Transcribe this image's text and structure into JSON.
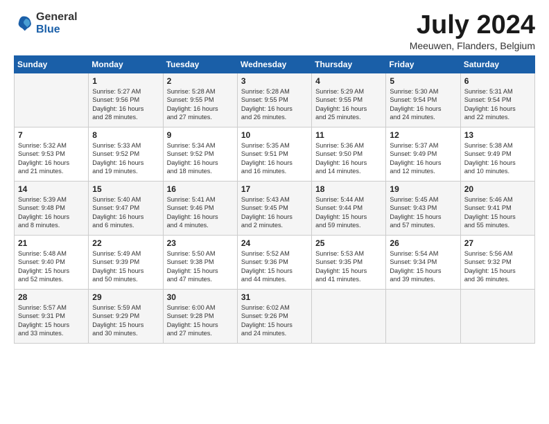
{
  "logo": {
    "general": "General",
    "blue": "Blue"
  },
  "title": "July 2024",
  "location": "Meeuwen, Flanders, Belgium",
  "days_header": [
    "Sunday",
    "Monday",
    "Tuesday",
    "Wednesday",
    "Thursday",
    "Friday",
    "Saturday"
  ],
  "weeks": [
    [
      {
        "day": "",
        "content": ""
      },
      {
        "day": "1",
        "content": "Sunrise: 5:27 AM\nSunset: 9:56 PM\nDaylight: 16 hours\nand 28 minutes."
      },
      {
        "day": "2",
        "content": "Sunrise: 5:28 AM\nSunset: 9:55 PM\nDaylight: 16 hours\nand 27 minutes."
      },
      {
        "day": "3",
        "content": "Sunrise: 5:28 AM\nSunset: 9:55 PM\nDaylight: 16 hours\nand 26 minutes."
      },
      {
        "day": "4",
        "content": "Sunrise: 5:29 AM\nSunset: 9:55 PM\nDaylight: 16 hours\nand 25 minutes."
      },
      {
        "day": "5",
        "content": "Sunrise: 5:30 AM\nSunset: 9:54 PM\nDaylight: 16 hours\nand 24 minutes."
      },
      {
        "day": "6",
        "content": "Sunrise: 5:31 AM\nSunset: 9:54 PM\nDaylight: 16 hours\nand 22 minutes."
      }
    ],
    [
      {
        "day": "7",
        "content": "Sunrise: 5:32 AM\nSunset: 9:53 PM\nDaylight: 16 hours\nand 21 minutes."
      },
      {
        "day": "8",
        "content": "Sunrise: 5:33 AM\nSunset: 9:52 PM\nDaylight: 16 hours\nand 19 minutes."
      },
      {
        "day": "9",
        "content": "Sunrise: 5:34 AM\nSunset: 9:52 PM\nDaylight: 16 hours\nand 18 minutes."
      },
      {
        "day": "10",
        "content": "Sunrise: 5:35 AM\nSunset: 9:51 PM\nDaylight: 16 hours\nand 16 minutes."
      },
      {
        "day": "11",
        "content": "Sunrise: 5:36 AM\nSunset: 9:50 PM\nDaylight: 16 hours\nand 14 minutes."
      },
      {
        "day": "12",
        "content": "Sunrise: 5:37 AM\nSunset: 9:49 PM\nDaylight: 16 hours\nand 12 minutes."
      },
      {
        "day": "13",
        "content": "Sunrise: 5:38 AM\nSunset: 9:49 PM\nDaylight: 16 hours\nand 10 minutes."
      }
    ],
    [
      {
        "day": "14",
        "content": "Sunrise: 5:39 AM\nSunset: 9:48 PM\nDaylight: 16 hours\nand 8 minutes."
      },
      {
        "day": "15",
        "content": "Sunrise: 5:40 AM\nSunset: 9:47 PM\nDaylight: 16 hours\nand 6 minutes."
      },
      {
        "day": "16",
        "content": "Sunrise: 5:41 AM\nSunset: 9:46 PM\nDaylight: 16 hours\nand 4 minutes."
      },
      {
        "day": "17",
        "content": "Sunrise: 5:43 AM\nSunset: 9:45 PM\nDaylight: 16 hours\nand 2 minutes."
      },
      {
        "day": "18",
        "content": "Sunrise: 5:44 AM\nSunset: 9:44 PM\nDaylight: 15 hours\nand 59 minutes."
      },
      {
        "day": "19",
        "content": "Sunrise: 5:45 AM\nSunset: 9:43 PM\nDaylight: 15 hours\nand 57 minutes."
      },
      {
        "day": "20",
        "content": "Sunrise: 5:46 AM\nSunset: 9:41 PM\nDaylight: 15 hours\nand 55 minutes."
      }
    ],
    [
      {
        "day": "21",
        "content": "Sunrise: 5:48 AM\nSunset: 9:40 PM\nDaylight: 15 hours\nand 52 minutes."
      },
      {
        "day": "22",
        "content": "Sunrise: 5:49 AM\nSunset: 9:39 PM\nDaylight: 15 hours\nand 50 minutes."
      },
      {
        "day": "23",
        "content": "Sunrise: 5:50 AM\nSunset: 9:38 PM\nDaylight: 15 hours\nand 47 minutes."
      },
      {
        "day": "24",
        "content": "Sunrise: 5:52 AM\nSunset: 9:36 PM\nDaylight: 15 hours\nand 44 minutes."
      },
      {
        "day": "25",
        "content": "Sunrise: 5:53 AM\nSunset: 9:35 PM\nDaylight: 15 hours\nand 41 minutes."
      },
      {
        "day": "26",
        "content": "Sunrise: 5:54 AM\nSunset: 9:34 PM\nDaylight: 15 hours\nand 39 minutes."
      },
      {
        "day": "27",
        "content": "Sunrise: 5:56 AM\nSunset: 9:32 PM\nDaylight: 15 hours\nand 36 minutes."
      }
    ],
    [
      {
        "day": "28",
        "content": "Sunrise: 5:57 AM\nSunset: 9:31 PM\nDaylight: 15 hours\nand 33 minutes."
      },
      {
        "day": "29",
        "content": "Sunrise: 5:59 AM\nSunset: 9:29 PM\nDaylight: 15 hours\nand 30 minutes."
      },
      {
        "day": "30",
        "content": "Sunrise: 6:00 AM\nSunset: 9:28 PM\nDaylight: 15 hours\nand 27 minutes."
      },
      {
        "day": "31",
        "content": "Sunrise: 6:02 AM\nSunset: 9:26 PM\nDaylight: 15 hours\nand 24 minutes."
      },
      {
        "day": "",
        "content": ""
      },
      {
        "day": "",
        "content": ""
      },
      {
        "day": "",
        "content": ""
      }
    ]
  ]
}
